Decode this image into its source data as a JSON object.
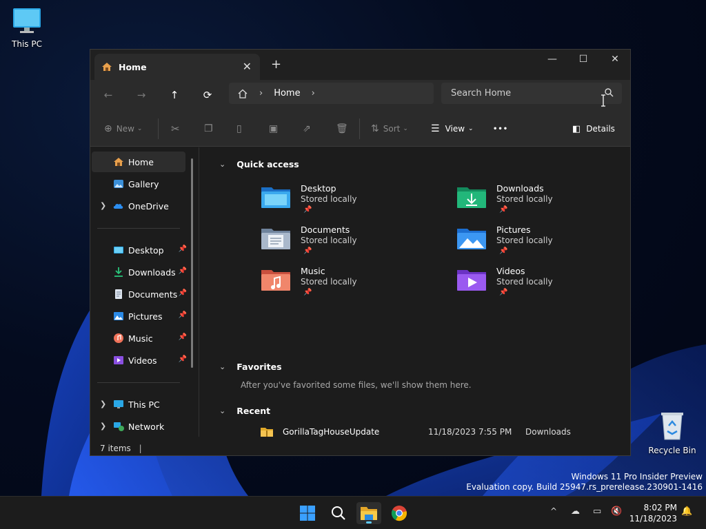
{
  "desktop": {
    "icons": [
      {
        "label": "This PC"
      },
      {
        "label": "Recycle Bin"
      }
    ],
    "watermark": {
      "line1": "Windows 11 Pro Insider Preview",
      "line2": "Evaluation copy. Build 25947.rs_prerelease.230901-1416"
    }
  },
  "window": {
    "tab": {
      "title": "Home",
      "close": "✕"
    },
    "new_tab": "+",
    "controls": {
      "minimize": "—",
      "maximize": "☐",
      "close": "✕"
    },
    "address": {
      "crumb": "Home"
    },
    "search": {
      "placeholder": "Search Home"
    },
    "commands": {
      "new": "New",
      "sort": "Sort",
      "view": "View",
      "more": "•••",
      "details": "Details"
    },
    "sidebar": {
      "top": [
        {
          "label": "Home"
        },
        {
          "label": "Gallery"
        },
        {
          "label": "OneDrive"
        }
      ],
      "pinned": [
        {
          "label": "Desktop"
        },
        {
          "label": "Downloads"
        },
        {
          "label": "Documents"
        },
        {
          "label": "Pictures"
        },
        {
          "label": "Music"
        },
        {
          "label": "Videos"
        }
      ],
      "bottom": [
        {
          "label": "This PC"
        },
        {
          "label": "Network"
        }
      ]
    },
    "sections": {
      "quick_access": "Quick access",
      "favorites": "Favorites",
      "favorites_note": "After you've favorited some files, we'll show them here.",
      "recent": "Recent"
    },
    "quick_access": [
      {
        "name": "Desktop",
        "sub": "Stored locally"
      },
      {
        "name": "Downloads",
        "sub": "Stored locally"
      },
      {
        "name": "Documents",
        "sub": "Stored locally"
      },
      {
        "name": "Pictures",
        "sub": "Stored locally"
      },
      {
        "name": "Music",
        "sub": "Stored locally"
      },
      {
        "name": "Videos",
        "sub": "Stored locally"
      }
    ],
    "recent": [
      {
        "name": "GorillaTagHouseUpdate",
        "date": "11/18/2023 7:55 PM",
        "location": "Downloads"
      }
    ],
    "status": {
      "items": "7 items"
    }
  },
  "taskbar": {
    "clock": {
      "time": "8:02 PM",
      "date": "11/18/2023"
    },
    "tray_chevron": "^"
  },
  "colors": {
    "accent": "#60cdff",
    "window_bg": "#1c1c1c",
    "bar_bg": "#2b2b2b"
  }
}
